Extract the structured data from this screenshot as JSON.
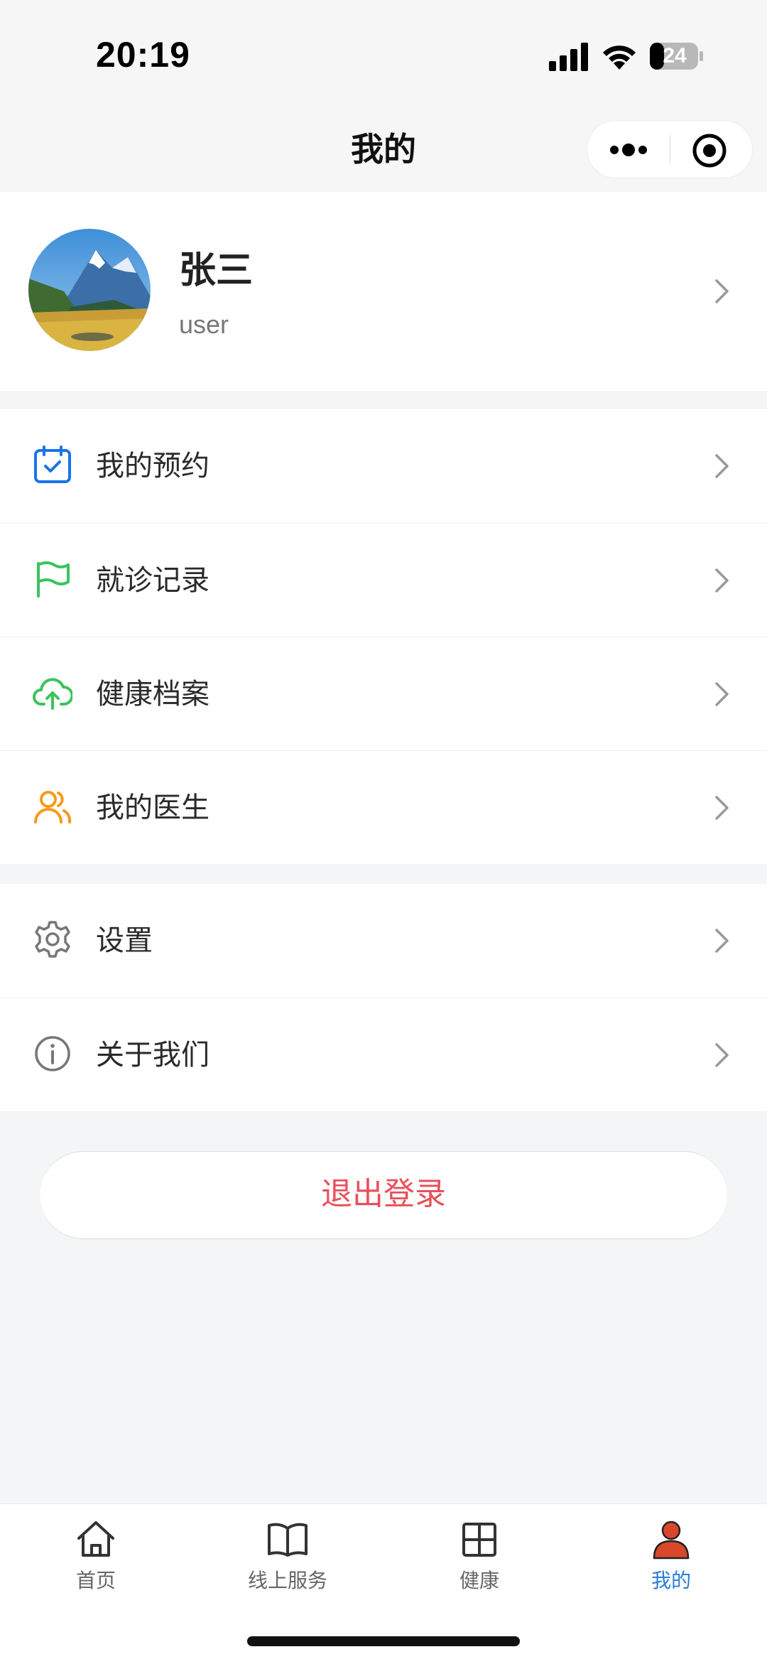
{
  "status_bar": {
    "time": "20:19",
    "battery": "24"
  },
  "nav": {
    "title": "我的"
  },
  "profile": {
    "name": "张三",
    "subtitle": "user"
  },
  "menu_group_1": [
    {
      "label": "我的预约",
      "icon": "calendar-check-icon",
      "color": "#1a73e8"
    },
    {
      "label": "就诊记录",
      "icon": "flag-icon",
      "color": "#3cc35c"
    },
    {
      "label": "健康档案",
      "icon": "cloud-upload-icon",
      "color": "#3cc35c"
    },
    {
      "label": "我的医生",
      "icon": "users-icon",
      "color": "#f59a1b"
    }
  ],
  "menu_group_2": [
    {
      "label": "设置",
      "icon": "gear-icon",
      "color": "#666666"
    },
    {
      "label": "关于我们",
      "icon": "info-icon",
      "color": "#666666"
    }
  ],
  "logout": {
    "label": "退出登录",
    "color": "#e8505b"
  },
  "tabs": [
    {
      "label": "首页",
      "icon": "home-icon"
    },
    {
      "label": "线上服务",
      "icon": "book-icon"
    },
    {
      "label": "健康",
      "icon": "grid-icon"
    },
    {
      "label": "我的",
      "icon": "user-icon",
      "active": true,
      "color": "#2a7dd8"
    }
  ]
}
